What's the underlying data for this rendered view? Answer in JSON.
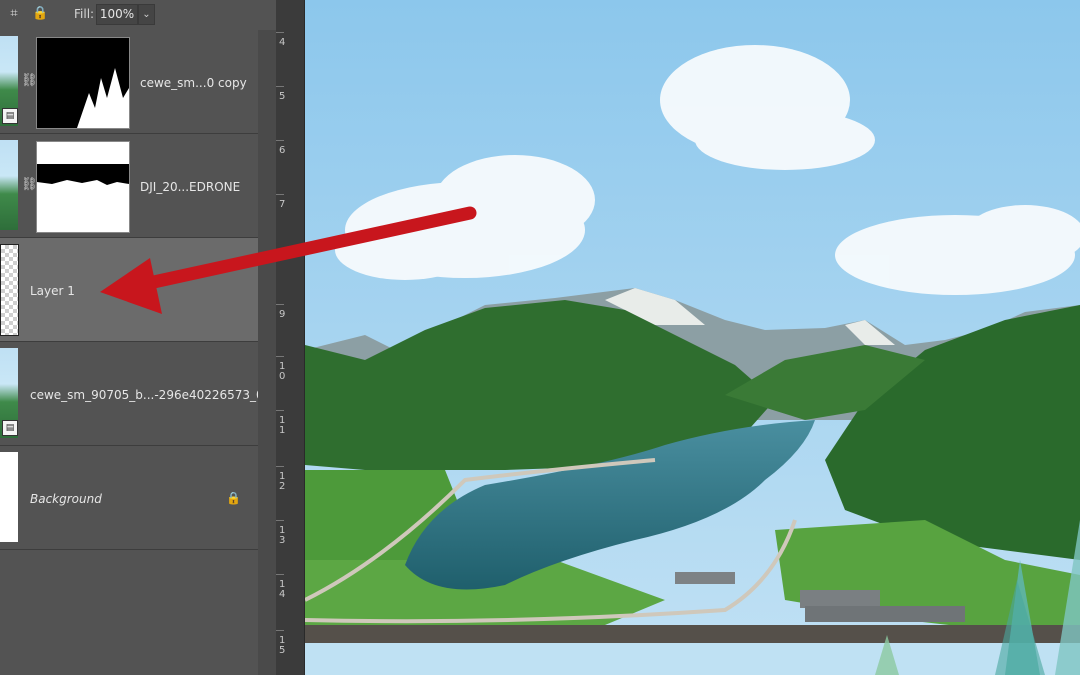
{
  "toolbar": {
    "fill_label": "Fill:",
    "fill_value": "100%",
    "icons": [
      "artboard-icon",
      "lock-icon",
      "chevron-down-icon"
    ]
  },
  "layers": [
    {
      "name": "cewe_sm...0 copy",
      "has_mask": true,
      "linked": true,
      "smart_object": true
    },
    {
      "name": "DJI_20...EDRONE",
      "has_mask": true,
      "linked": true,
      "smart_object": false
    },
    {
      "name": "Layer 1",
      "selected": true,
      "transparent": true
    },
    {
      "name": "cewe_sm_90705_b...-296e40226573_0",
      "smart_object": true
    },
    {
      "name": "Background",
      "locked": true
    }
  ],
  "ruler": {
    "ticks": [
      {
        "label": "4"
      },
      {
        "label": "5"
      },
      {
        "label": "6"
      },
      {
        "label": "7"
      },
      {
        "label": "9"
      },
      {
        "label": "1\n0"
      },
      {
        "label": "1\n1"
      },
      {
        "label": "1\n2"
      },
      {
        "label": "1\n3"
      },
      {
        "label": "1\n4"
      },
      {
        "label": "1\n5"
      }
    ]
  },
  "annotation": {
    "color": "#c8161d"
  }
}
